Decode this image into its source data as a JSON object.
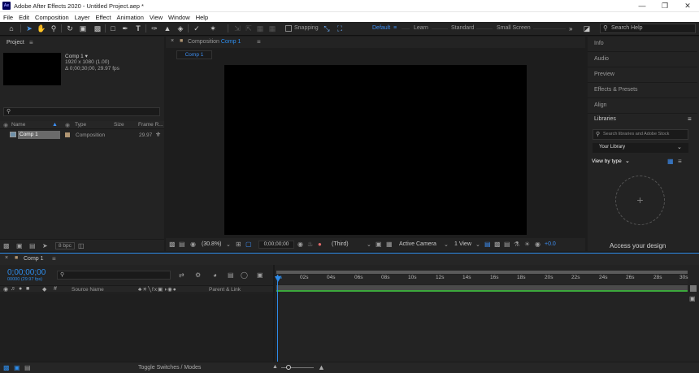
{
  "app": {
    "title": "Adobe After Effects 2020 - Untitled Project.aep *",
    "logo_text": "Ae"
  },
  "menu": [
    "File",
    "Edit",
    "Composition",
    "Layer",
    "Effect",
    "Animation",
    "View",
    "Window",
    "Help"
  ],
  "toolbar": {
    "snapping_label": "Snapping",
    "workspaces": [
      "Default",
      "Learn",
      "Standard",
      "Small Screen"
    ],
    "active_workspace": "Default",
    "search_placeholder": "Search Help"
  },
  "project": {
    "tab_label": "Project",
    "comp_name": "Comp 1 ▾",
    "comp_size": "1920 x 1080 (1.00)",
    "comp_duration": "Δ 0;00;30;00, 29.97 fps",
    "columns": {
      "name": "Name",
      "type": "Type",
      "size": "Size",
      "frame_rate": "Frame R..."
    },
    "items": [
      {
        "name": "Comp 1",
        "type": "Composition",
        "size": "",
        "frame_rate": "29.97"
      }
    ],
    "bpc_label": "8 bpc"
  },
  "composition": {
    "panel_label": "Composition",
    "comp_name": "Comp 1",
    "comp_tab": "Comp 1",
    "zoom": "(30.8%)",
    "timecode": "0;00;00;00",
    "resolution": "(Third)",
    "camera": "Active Camera",
    "view": "1 View",
    "exposure": "+0.0"
  },
  "right_panels": {
    "items": [
      "Info",
      "Audio",
      "Preview",
      "Effects & Presets",
      "Align"
    ],
    "libraries": {
      "label": "Libraries",
      "search_placeholder": "Search libraries and Adobe Stock",
      "library_select": "Your Library",
      "view_by": "View by type",
      "cta": "Access your design"
    }
  },
  "timeline": {
    "comp_tab": "Comp 1",
    "timecode": "0;00;00;00",
    "timecode_sub": "00000 (29.97 fps)",
    "columns": {
      "source_name": "Source Name",
      "parent": "Parent & Link"
    },
    "ruler": [
      "0s",
      "02s",
      "04s",
      "06s",
      "08s",
      "10s",
      "12s",
      "14s",
      "16s",
      "18s",
      "20s",
      "22s",
      "24s",
      "26s",
      "28s",
      "30s"
    ],
    "footer_label": "Toggle Switches / Modes"
  },
  "colors": {
    "accent": "#2d8ceb",
    "panel_bg": "#232323",
    "app_bg": "#1d1d1d",
    "work_area": "#4b4b4b",
    "timeline_green": "#3ca83c"
  }
}
